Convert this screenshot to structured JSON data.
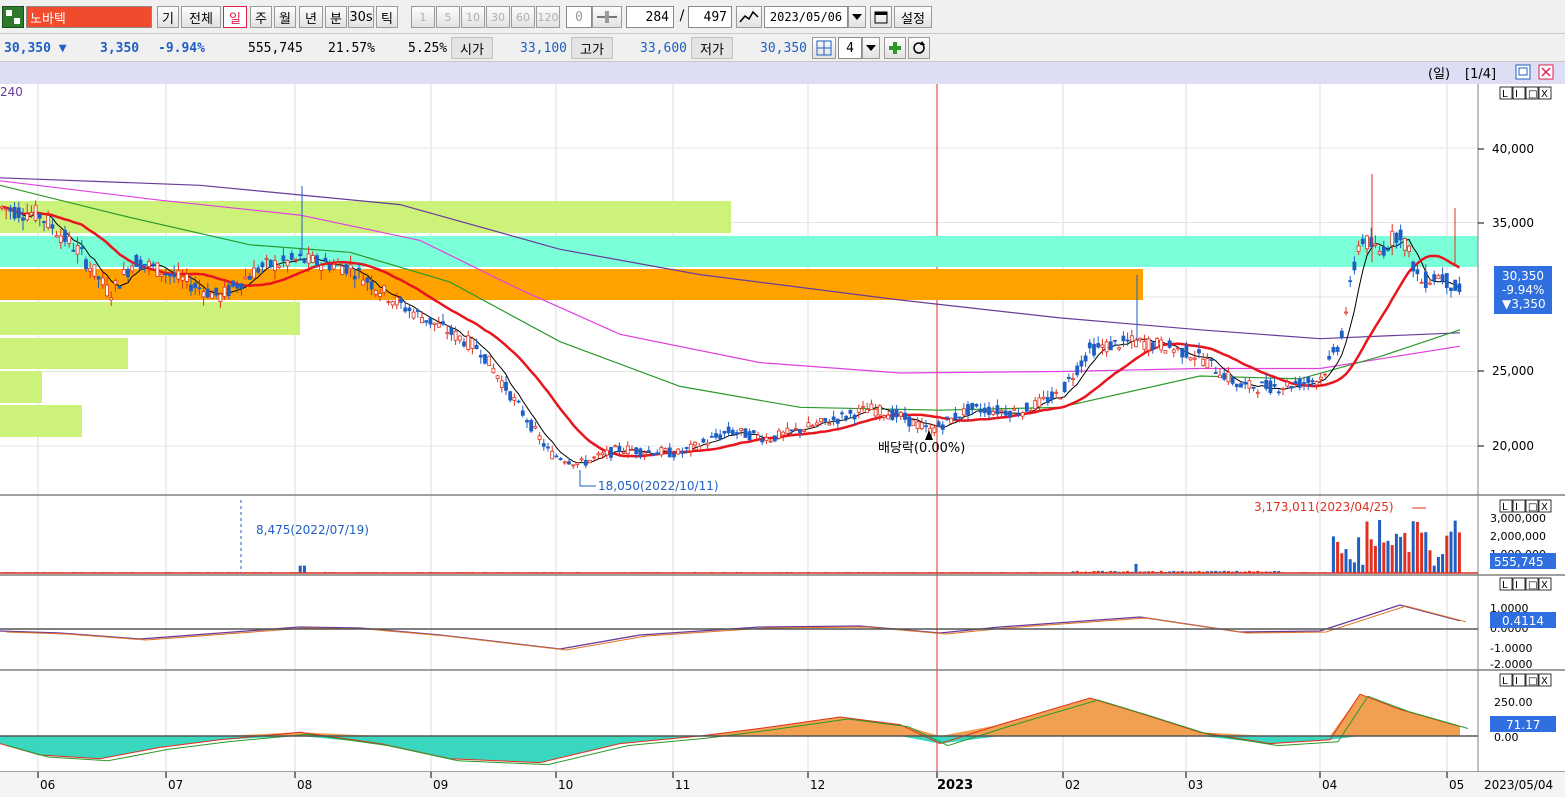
{
  "toolbar": {
    "stock_name": "노바텍",
    "periods": [
      "기",
      "전체",
      "일",
      "주",
      "월",
      "년",
      "분",
      "30s",
      "틱"
    ],
    "active_period": "일",
    "minute_options": [
      "1",
      "5",
      "10",
      "30",
      "60",
      "120"
    ],
    "count_value": "0",
    "page_current": "284",
    "page_total": "497",
    "date": "2023/05/06",
    "settings_label": "설정"
  },
  "quote": {
    "price": "30,350",
    "arrow": "▼",
    "change": "3,350",
    "change_pct": "-9.94%",
    "volume": "555,745",
    "turnover": "21.57%",
    "ratio": "5.25%",
    "open_label": "시가",
    "open": "33,100",
    "high_label": "고가",
    "high": "33,600",
    "low_label": "저가",
    "low": "30,350",
    "grid_count": "4"
  },
  "chart_header": {
    "mode": "(일)",
    "page": "[1/4]"
  },
  "main_panel": {
    "ma_label": "240",
    "y_ticks": [
      "40,000",
      "35,000",
      "25,000",
      "20,000"
    ],
    "price_tag": [
      "30,350",
      "-9.94%",
      "▼3,350"
    ],
    "low_annotation": "18,050(2022/10/11)",
    "dividend_annotation": "배당락(0.00%)"
  },
  "volume_panel": {
    "y_ticks": [
      "3,000,000",
      "2,000,000",
      "1,000,000"
    ],
    "value_tag": "555,745",
    "max_annotation": "3,173,011(2023/04/25)",
    "min_annotation": "8,475(2022/07/19)"
  },
  "macd_panel": {
    "y_ticks": [
      "1.0000",
      "0.0000",
      "-1.0000",
      "-2.0000"
    ],
    "value_tag": "0.4114"
  },
  "osc_panel": {
    "y_ticks": [
      "250.00",
      "0.00"
    ],
    "value_tag": "71.17"
  },
  "x_axis": {
    "labels": [
      "06",
      "07",
      "08",
      "09",
      "10",
      "11",
      "12",
      "2023",
      "02",
      "03",
      "04",
      "05"
    ],
    "end_date": "2023/05/04"
  },
  "colors": {
    "up": "#e0301e",
    "down": "#1f5fc4",
    "ma5": "#000000",
    "ma20": "#e8141e",
    "ma60": "#2a9a2a",
    "ma120": "#e040e0",
    "ma240": "#6a3a9a",
    "zone_lime": "#cdf27a",
    "zone_aqua": "#7affd8",
    "zone_orange": "#ffa200",
    "tag_blue": "#2f6fe0"
  }
}
